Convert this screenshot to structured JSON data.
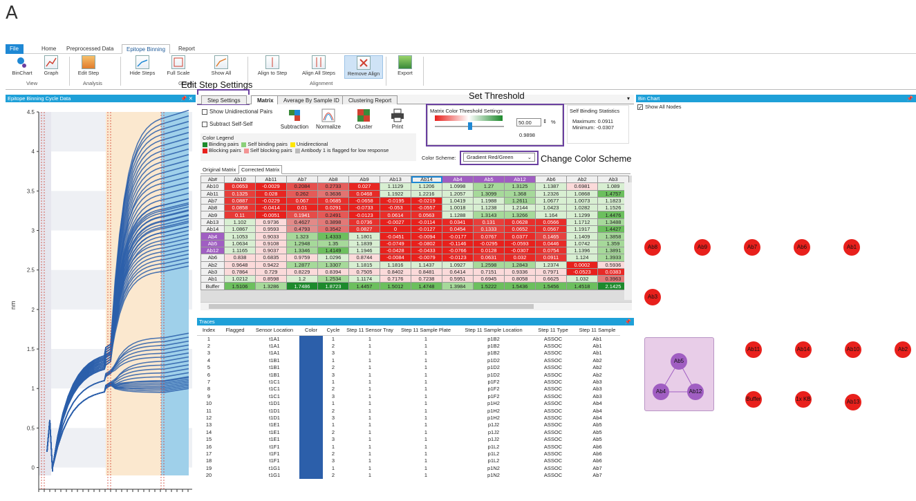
{
  "figure_label": "A",
  "menu": {
    "tabs": [
      "File",
      "Home",
      "Preprocessed Data",
      "Epitope Binning",
      "Report"
    ],
    "active": "Epitope Binning"
  },
  "ribbon": {
    "buttons": {
      "binchart": "BinChart",
      "graph": "Graph",
      "edit_step": "Edit Step",
      "hide_steps": "Hide Steps",
      "full_scale": "Full Scale",
      "show_all": "Show All",
      "align_to_step": "Align to Step",
      "align_all_steps": "Align All Steps",
      "remove_align": "Remove Align",
      "export": "Export"
    },
    "groups": {
      "view": "View",
      "analysis": "Analysis",
      "graph": "Graph",
      "alignment": "Alignment"
    }
  },
  "annotations": {
    "edit_step_settings": "Edit Step Settings",
    "set_threshold": "Set Threshold",
    "change_color_scheme": "Change Color Scheme"
  },
  "left_panel": {
    "title": "Epitope Binning Cycle Data",
    "y_axis_label": "nm",
    "y_ticks": [
      "4.5",
      "4",
      "3.5",
      "3",
      "2.5",
      "2",
      "1.5",
      "1",
      "0.5",
      "0"
    ]
  },
  "mid_tabs": [
    "Step Settings",
    "Matrix",
    "Average By Sample ID",
    "Clustering Report"
  ],
  "matrix_options": {
    "show_unidirectional": "Show Unidirectional Pairs",
    "subtract_self": "Subtract Self-Self",
    "subtraction": "Subtraction",
    "normalize": "Normalize",
    "cluster": "Cluster",
    "print": "Print",
    "color_legend_title": "Color Legend",
    "legend": [
      "Binding pairs",
      "Self binding pairs",
      "Unidirectional",
      "Blocking pairs",
      "Self blocking pairs",
      "Antibody 1 is flagged for low response"
    ],
    "threshold_title": "Matrix Color Threshold Settings",
    "threshold_value": "50.00",
    "threshold_unit": "%",
    "threshold_computed": "0.9898",
    "color_scheme_label": "Color Scheme:",
    "color_scheme_value": "Gradient Red/Green",
    "self_binding_title": "Self Binding Statistics",
    "max": "Maximum: 0.0911",
    "min": "Minimum: -0.0307",
    "subtabs": [
      "Original Matrix",
      "Corrected Matrix"
    ]
  },
  "matrix": {
    "corner": "Ab#",
    "cols": [
      "Ab10",
      "Ab11",
      "Ab7",
      "Ab8",
      "Ab9",
      "Ab13",
      "Ab14",
      "Ab4",
      "Ab5",
      "Ab12",
      "Ab6",
      "Ab2",
      "Ab3"
    ],
    "rows": [
      {
        "h": "Ab10",
        "v": [
          "0.0653",
          "-0.0029",
          "0.2084",
          "0.2733",
          "0.027",
          "1.1129",
          "1.1206",
          "1.0998",
          "1.27",
          "1.3125",
          "1.1387",
          "0.6981",
          "1.089"
        ]
      },
      {
        "h": "Ab11",
        "v": [
          "0.1325",
          "0.028",
          "0.262",
          "0.3636",
          "0.0468",
          "1.1922",
          "1.2216",
          "1.2057",
          "1.3099",
          "1.368",
          "1.2326",
          "1.0868",
          "1.4757"
        ]
      },
      {
        "h": "Ab7",
        "v": [
          "0.0887",
          "-0.0229",
          "0.067",
          "0.0685",
          "-0.0658",
          "-0.0195",
          "-0.0219",
          "1.0419",
          "1.1988",
          "1.2611",
          "1.0677",
          "1.0073",
          "1.1823"
        ]
      },
      {
        "h": "Ab8",
        "v": [
          "0.0858",
          "-0.0414",
          "0.01",
          "0.0291",
          "-0.0733",
          "-0.053",
          "-0.0557",
          "1.0018",
          "1.1238",
          "1.2144",
          "1.0423",
          "1.0282",
          "1.1526"
        ]
      },
      {
        "h": "Ab9",
        "v": [
          "0.11",
          "-0.0051",
          "0.1941",
          "0.2491",
          "-0.0123",
          "0.0614",
          "0.0563",
          "1.1288",
          "1.3143",
          "1.3266",
          "1.164",
          "1.1299",
          "1.4476"
        ]
      },
      {
        "h": "Ab13",
        "v": [
          "1.102",
          "0.9736",
          "0.4627",
          "0.3898",
          "0.0736",
          "-0.0027",
          "-0.0114",
          "0.0341",
          "0.131",
          "0.0628",
          "0.0566",
          "1.1712",
          "1.3488"
        ]
      },
      {
        "h": "Ab14",
        "v": [
          "1.0867",
          "0.9593",
          "0.4793",
          "0.3542",
          "0.0827",
          "0",
          "-0.0127",
          "0.0454",
          "0.1333",
          "0.0652",
          "0.0567",
          "1.1917",
          "1.4427"
        ]
      },
      {
        "h": "Ab4",
        "v": [
          "1.1053",
          "0.9033",
          "1.323",
          "1.4333",
          "1.1801",
          "-0.0451",
          "-0.0094",
          "-0.0177",
          "0.0767",
          "0.0377",
          "0.1465",
          "1.1409",
          "1.3858"
        ]
      },
      {
        "h": "Ab5",
        "v": [
          "1.0634",
          "0.9108",
          "1.2948",
          "1.35",
          "1.1839",
          "-0.0749",
          "-0.0802",
          "-0.1146",
          "-0.0295",
          "-0.0593",
          "0.0446",
          "1.0742",
          "1.359"
        ]
      },
      {
        "h": "Ab12",
        "v": [
          "1.1165",
          "0.9037",
          "1.3346",
          "1.4149",
          "1.1946",
          "-0.0428",
          "-0.0433",
          "-0.0766",
          "0.0128",
          "-0.0307",
          "0.0754",
          "1.1396",
          "1.3891"
        ]
      },
      {
        "h": "Ab6",
        "v": [
          "0.838",
          "0.6835",
          "0.9759",
          "1.0296",
          "0.8744",
          "-0.0084",
          "-0.0079",
          "-0.0123",
          "0.0631",
          "0.032",
          "0.0911",
          "1.124",
          "1.3933"
        ]
      },
      {
        "h": "Ab2",
        "v": [
          "0.9648",
          "0.9422",
          "1.2877",
          "1.3307",
          "1.1815",
          "1.1816",
          "1.1437",
          "1.0927",
          "1.2598",
          "1.2843",
          "1.2374",
          "0.0002",
          "0.5936"
        ]
      },
      {
        "h": "Ab3",
        "v": [
          "0.7864",
          "0.729",
          "0.8229",
          "0.8394",
          "0.7505",
          "0.8402",
          "0.8481",
          "0.6414",
          "0.7151",
          "0.9336",
          "0.7971",
          "-0.0523",
          "0.0383"
        ]
      },
      {
        "h": "Ab1",
        "v": [
          "1.0212",
          "0.8598",
          "1.2",
          "1.2534",
          "1.1174",
          "0.7176",
          "0.7238",
          "0.5951",
          "0.6945",
          "0.8058",
          "0.6625",
          "1.032",
          "0.3963"
        ]
      },
      {
        "h": "Buffer",
        "v": [
          "1.5106",
          "1.3286",
          "1.7486",
          "1.8723",
          "1.4457",
          "1.5012",
          "1.4748",
          "1.3984",
          "1.5222",
          "1.5436",
          "1.5456",
          "1.4518",
          "2.1425"
        ]
      }
    ],
    "purple_cols": [
      "Ab4",
      "Ab5",
      "Ab12"
    ]
  },
  "traces": {
    "title": "Traces",
    "columns": [
      "Index",
      "Flagged",
      "Sensor Location",
      "Color",
      "Cycle",
      "Step 11 Sensor Tray",
      "Step 11 Sample Plate",
      "Step 11 Sample Location",
      "Step 11 Type",
      "Step 11 Sample"
    ],
    "rows": [
      [
        "1",
        "",
        "t1A1",
        "",
        "1",
        "1",
        "1",
        "p1B2",
        "ASSOC",
        "Ab1"
      ],
      [
        "2",
        "",
        "t1A1",
        "",
        "2",
        "1",
        "1",
        "p1B2",
        "ASSOC",
        "Ab1"
      ],
      [
        "3",
        "",
        "t1A1",
        "",
        "3",
        "1",
        "1",
        "p1B2",
        "ASSOC",
        "Ab1"
      ],
      [
        "4",
        "",
        "t1B1",
        "",
        "1",
        "1",
        "1",
        "p1D2",
        "ASSOC",
        "Ab2"
      ],
      [
        "5",
        "",
        "t1B1",
        "",
        "2",
        "1",
        "1",
        "p1D2",
        "ASSOC",
        "Ab2"
      ],
      [
        "6",
        "",
        "t1B1",
        "",
        "3",
        "1",
        "1",
        "p1D2",
        "ASSOC",
        "Ab2"
      ],
      [
        "7",
        "",
        "t1C1",
        "",
        "1",
        "1",
        "1",
        "p1F2",
        "ASSOC",
        "Ab3"
      ],
      [
        "8",
        "",
        "t1C1",
        "",
        "2",
        "1",
        "1",
        "p1F2",
        "ASSOC",
        "Ab3"
      ],
      [
        "9",
        "",
        "t1C1",
        "",
        "3",
        "1",
        "1",
        "p1F2",
        "ASSOC",
        "Ab3"
      ],
      [
        "10",
        "",
        "t1D1",
        "",
        "1",
        "1",
        "1",
        "p1H2",
        "ASSOC",
        "Ab4"
      ],
      [
        "11",
        "",
        "t1D1",
        "",
        "2",
        "1",
        "1",
        "p1H2",
        "ASSOC",
        "Ab4"
      ],
      [
        "12",
        "",
        "t1D1",
        "",
        "3",
        "1",
        "1",
        "p1H2",
        "ASSOC",
        "Ab4"
      ],
      [
        "13",
        "",
        "t1E1",
        "",
        "1",
        "1",
        "1",
        "p1J2",
        "ASSOC",
        "Ab5"
      ],
      [
        "14",
        "",
        "t1E1",
        "",
        "2",
        "1",
        "1",
        "p1J2",
        "ASSOC",
        "Ab5"
      ],
      [
        "15",
        "",
        "t1E1",
        "",
        "3",
        "1",
        "1",
        "p1J2",
        "ASSOC",
        "Ab5"
      ],
      [
        "16",
        "",
        "t1F1",
        "",
        "1",
        "1",
        "1",
        "p1L2",
        "ASSOC",
        "Ab6"
      ],
      [
        "17",
        "",
        "t1F1",
        "",
        "2",
        "1",
        "1",
        "p1L2",
        "ASSOC",
        "Ab6"
      ],
      [
        "18",
        "",
        "t1F1",
        "",
        "3",
        "1",
        "1",
        "p1L2",
        "ASSOC",
        "Ab6"
      ],
      [
        "19",
        "",
        "t1G1",
        "",
        "1",
        "1",
        "1",
        "p1N2",
        "ASSOC",
        "Ab7"
      ],
      [
        "20",
        "",
        "t1G1",
        "",
        "2",
        "1",
        "1",
        "p1N2",
        "ASSOC",
        "Ab7"
      ]
    ],
    "trace_color": "#2c5faa"
  },
  "bin_chart": {
    "title": "Bin Chart",
    "show_all_nodes": "Show All Nodes",
    "nodes_row1": [
      "Ab8",
      "Ab9",
      "Ab7",
      "Ab6",
      "Ab1"
    ],
    "node_solo": "Ab3",
    "nodes_row2": [
      "Ab11",
      "Ab14",
      "Ab10",
      "Ab2"
    ],
    "nodes_row3": [
      "Buffer",
      "1x KB",
      "Ab13"
    ],
    "cluster": [
      "Ab5",
      "Ab4",
      "Ab12"
    ],
    "node_color": "#e8201c",
    "cluster_color": "#a05ec2"
  }
}
